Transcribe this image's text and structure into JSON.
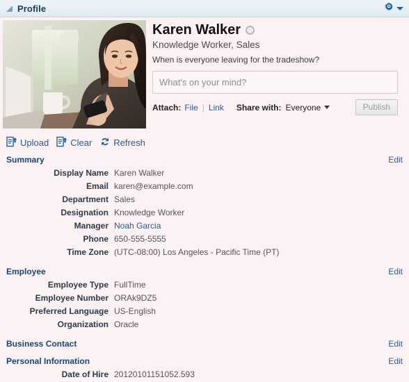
{
  "window": {
    "title": "Profile",
    "collapse_icon": "triangle-collapse-icon",
    "settings_icon": "gear-icon"
  },
  "profile": {
    "name": "Karen Walker",
    "presence": "offline",
    "subtitle": "Knowledge Worker, Sales",
    "status_message": "When is everyone leaving for the tradeshow?",
    "photo_alt": "woman-at-laptop-photo"
  },
  "composer": {
    "placeholder": "What's on your mind?",
    "value": "",
    "attach_label": "Attach:",
    "attach_file": "File",
    "attach_link": "Link",
    "share_label": "Share with:",
    "share_value": "Everyone",
    "publish_label": "Publish",
    "publish_disabled": true
  },
  "toolbar": {
    "items": [
      {
        "label": "Upload",
        "icon": "document-upload-icon"
      },
      {
        "label": "Clear",
        "icon": "document-clear-icon"
      },
      {
        "label": "Refresh",
        "icon": "refresh-icon"
      }
    ]
  },
  "edit_label": "Edit",
  "sections": [
    {
      "title": "Summary",
      "edit": "Edit",
      "rows": [
        {
          "label": "Display Name",
          "value": "Karen Walker",
          "link": false
        },
        {
          "label": "Email",
          "value": "karen@example.com",
          "link": false
        },
        {
          "label": "Department",
          "value": "Sales",
          "link": false
        },
        {
          "label": "Designation",
          "value": "Knowledge Worker",
          "link": false
        },
        {
          "label": "Manager",
          "value": "Noah Garcia",
          "link": true
        },
        {
          "label": "Phone",
          "value": "650-555-5555",
          "link": false
        },
        {
          "label": "Time Zone",
          "value": "(UTC-08:00) Los Angeles - Pacific Time (PT)",
          "link": false
        }
      ]
    },
    {
      "title": "Employee",
      "edit": "Edit",
      "rows": [
        {
          "label": "Employee Type",
          "value": "FullTime",
          "link": false
        },
        {
          "label": "Employee Number",
          "value": "ORAk9DZ5",
          "link": false
        },
        {
          "label": "Preferred Language",
          "value": "US-English",
          "link": false
        },
        {
          "label": "Organization",
          "value": "Oracle",
          "link": false
        }
      ]
    },
    {
      "title": "Business Contact",
      "edit": "Edit",
      "rows": []
    },
    {
      "title": "Personal Information",
      "edit": "Edit",
      "rows": [
        {
          "label": "Date of Hire",
          "value": "20120101151052.593",
          "link": false
        }
      ]
    }
  ],
  "colors": {
    "page_background": "#fdf2f3",
    "titlebar": "#e7f0f4",
    "link": "#2159a5",
    "section_title": "#17457a",
    "label": "#2b3a4a",
    "value": "#555555"
  }
}
